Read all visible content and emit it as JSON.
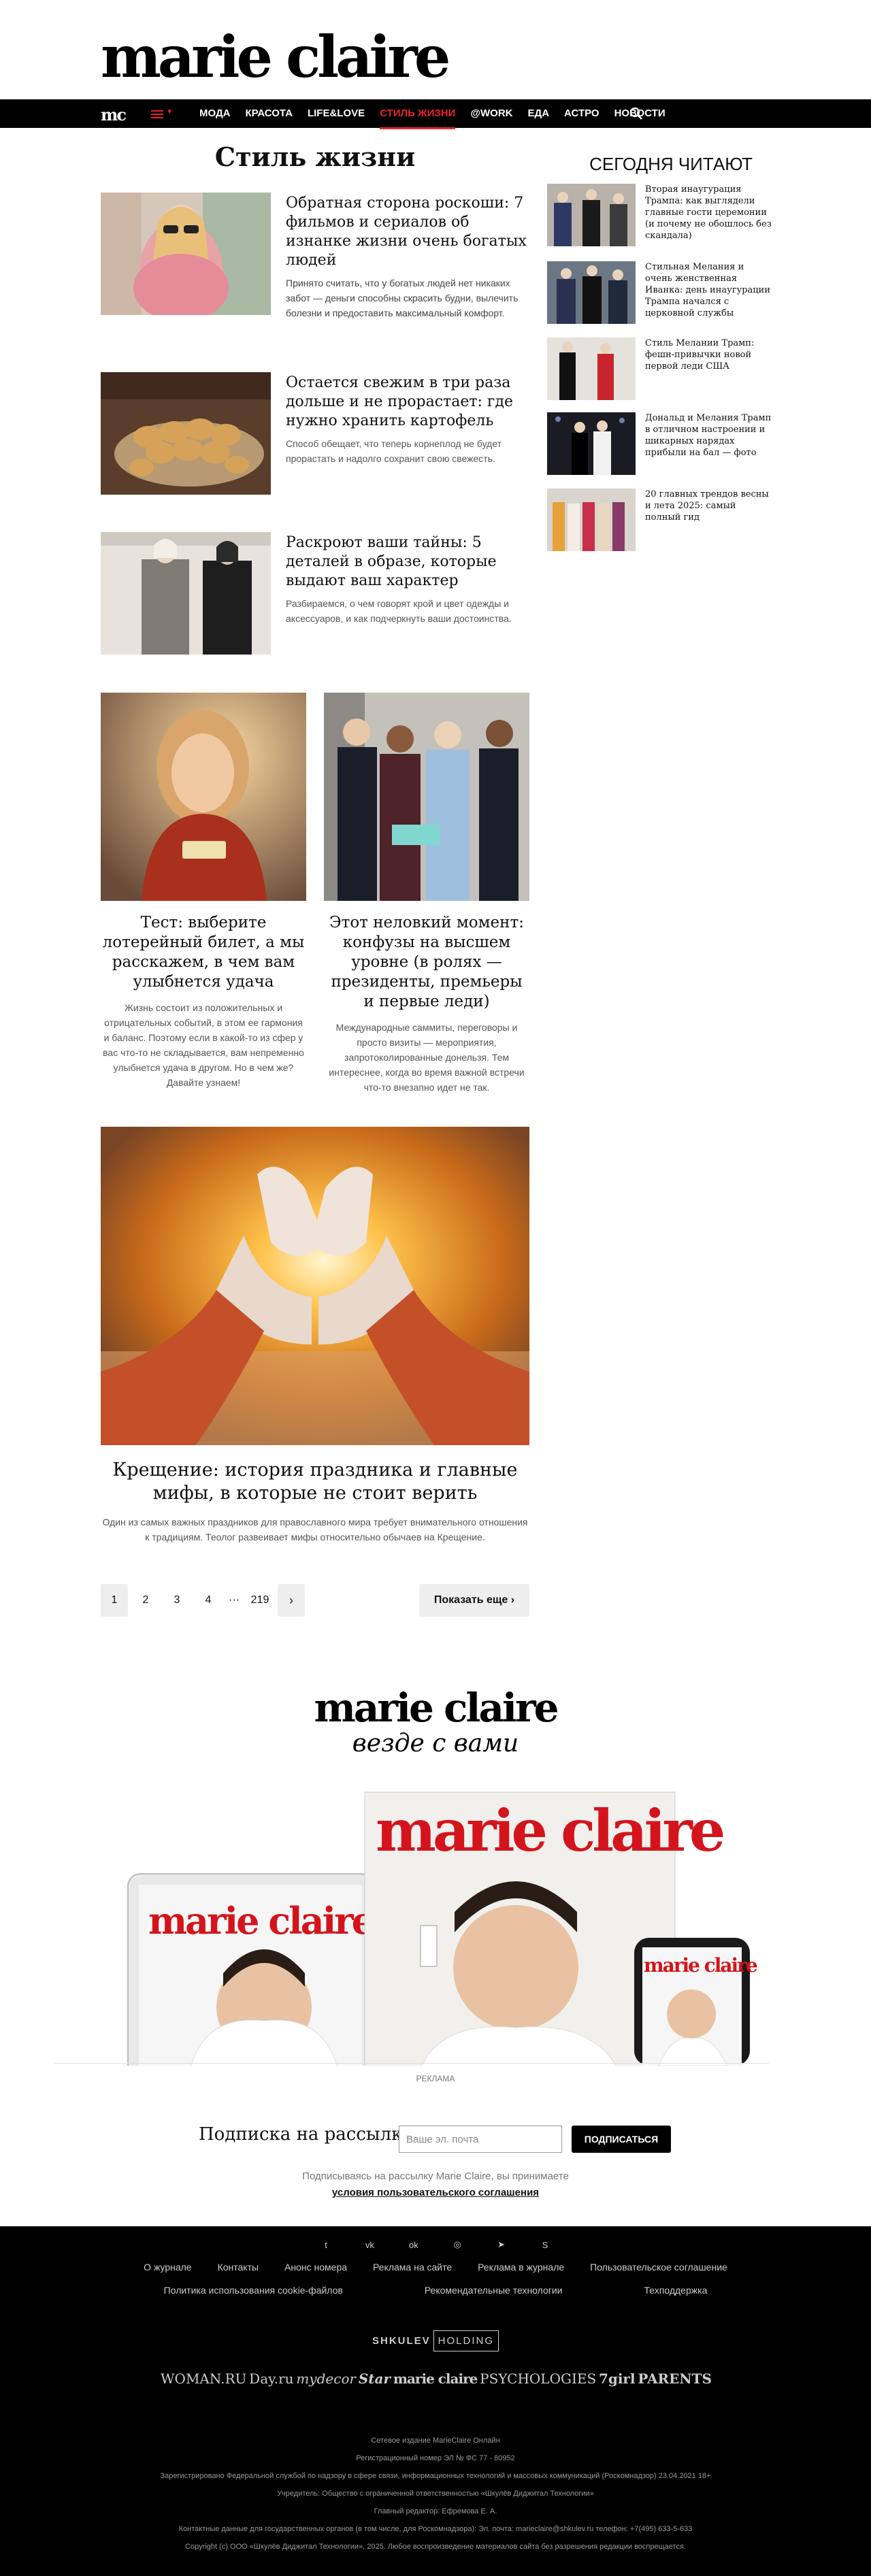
{
  "header": {
    "logo": "marie claire",
    "nav_mc": "mc",
    "nav_items": [
      "МОДА",
      "КРАСОТА",
      "LIFE&LOVE",
      "СТИЛЬ ЖИЗНИ",
      "@WORK",
      "ЕДА",
      "АСТРО",
      "НОВОСТИ"
    ]
  },
  "section_title": "Стиль жизни",
  "articles": [
    {
      "title": "Обратная сторона роскоши: 7 фильмов и сериалов об изнанке жизни очень богатых людей",
      "excerpt": "Принято считать, что у богатых людей нет никаких забот — деньги способны скрасить будни, вылечить болезни и предоставить максимальный комфорт. Однако даже за массив"
    },
    {
      "title": "Остается свежим в три раза дольше и не прорастает: где нужно хранить картофель",
      "excerpt": "Способ обещает, что теперь корнеплод не будет прорастать и надолго сохранит свою свежесть."
    },
    {
      "title": "Раскроют ваши тайны: 5 деталей в образе, которые выдают ваш характер",
      "excerpt": "Разбираемся, о чем говорят крой и цвет одежды и аксессуаров, и как подчеркнуть ваши достоинства."
    }
  ],
  "sidebar": {
    "title": "СЕГОДНЯ ЧИТАЮТ",
    "items": [
      "Вторая инаугурация Трампа: как выглядели главные гости церемонии (и почему не обошлось без скандала)",
      "Стильная Мелания и очень женственная Иванка: день инаугурации Трампа начался с церковной службы",
      "Стиль Мелании Трамп: фешн-привычки новой первой леди США",
      "Дональд и Мелания Трамп в отличном настроении и шикарных нарядах прибыли на бал — фото",
      "20 главных трендов весны и лета 2025: самый полный гид"
    ]
  },
  "cards": [
    {
      "title": "Тест: выберите лотерейный билет, а мы расскажем, в чем вам улыбнется удача",
      "excerpt": "Жизнь состоит из положительных и отрицательных событий, в этом ее гармония и баланс. Поэтому если в какой-то из сфер у вас что-то не складывается, вам непременно улыбнется удача в другом. Но в чем же? Давайте узнаем!"
    },
    {
      "title": "Этот неловкий момент: конфузы на высшем уровне (в ролях — президенты, премьеры и первые леди)",
      "excerpt": "Международные саммиты, переговоры и просто визиты — мероприятия, запротоколированные донельзя. Тем интереснее, когда во время важной встречи что-то внезапно идет не так."
    }
  ],
  "feature": {
    "title": "Крещение: история праздника и главные мифы, в которые не стоит верить",
    "excerpt": "Один из самых важных праздников для православного мира требует внимательного отношения к традициям. Теолог развеивает мифы относительно обычаев на Крещение."
  },
  "pagination": {
    "pages": [
      "1",
      "2",
      "3",
      "4",
      "···",
      "219"
    ],
    "next": "›",
    "more": "Показать еще"
  },
  "promo": {
    "logo": "marie claire",
    "tagline": "везде с вами",
    "cover_logo": "marie claire",
    "ad_label": "РЕКЛАМА"
  },
  "newsletter": {
    "label": "Подписка на рассылку",
    "placeholder": "Ваше эл. почта",
    "button": "ПОДПИСАТЬСЯ",
    "note": "Подписываясь на рассылку Marie Claire, вы принимаете",
    "link": "условия пользовательского соглашения"
  },
  "footer": {
    "social_icons": [
      "twitter-icon",
      "vk-icon",
      "ok-icon",
      "viber-icon",
      "telegram-icon",
      "skype-icon"
    ],
    "social_glyphs": [
      "t",
      "vk",
      "ok",
      "◎",
      "➤",
      "S"
    ],
    "links_row1": [
      "О журнале",
      "Контакты",
      "Анонс номера",
      "Реклама на сайте",
      "Реклама в журнале",
      "Пользовательское соглашение"
    ],
    "links_row2": [
      "Политика использования cookie-файлов",
      "Рекомендательные технологии",
      "Техподдержка"
    ],
    "holding_a": "SHKULEV",
    "holding_b": "HOLDING",
    "brands": [
      "WOMAN.RU",
      "Day.ru",
      "mydecor",
      "Star",
      "marie claire",
      "PSYCHOLOGIES",
      "7girl",
      "PARENTS"
    ],
    "legal": [
      "Сетевое издание MarieClaire Онлайн",
      "Регистрационный номер ЭЛ № ФС 77 - 80952",
      "Зарегистрировано Федеральной службой по надзору в сфере связи, информационных технологий и массовых коммуникаций (Роскомнадзор) 23.04.2021 18+",
      "Учредитель: Общество с ограниченной ответственностью «Шкулёв Диджитал Технологии»",
      "Главный редактор: Ефремова Е. А.",
      "Контактные данные для государственных органов (в том числе, для Роскомнадзора): Эл. почта: marieclaire@shkulev.ru телефон: +7(495) 633-5-633",
      "Copyright (c) ООО «Шкулёв Диджитал Технологии», 2025. Любое воспроизведение материалов сайта без разрешения редакции воспрещается."
    ]
  }
}
